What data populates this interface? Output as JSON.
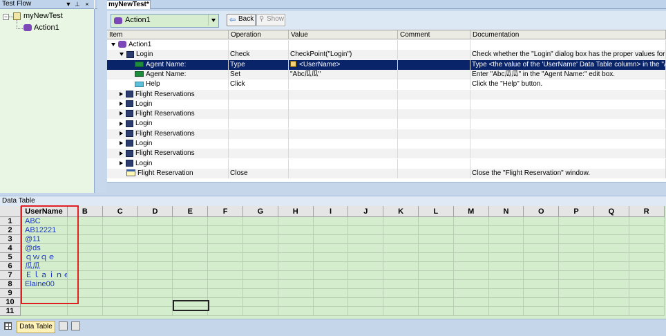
{
  "test_flow": {
    "title": "Test Flow",
    "header_buttons": [
      "▼",
      "⊥",
      "×"
    ],
    "root": "myNewTest",
    "child": "Action1"
  },
  "document": {
    "tab_label": "myNewTest*",
    "action_selected": "Action1",
    "back_label": "Back",
    "show_label": "Show",
    "columns": [
      "Item",
      "Operation",
      "Value",
      "Comment",
      "Documentation"
    ],
    "rows": [
      {
        "expander": "down",
        "icon": "action",
        "item": "Action1",
        "operation": "",
        "value": "",
        "comment": "",
        "documentation": "",
        "indent": 0
      },
      {
        "expander": "down",
        "icon": "obj",
        "item": "Login",
        "operation": "Check",
        "value": "CheckPoint(\"Login\")",
        "comment": "",
        "documentation": "Check whether the \"Login\" dialog box has the proper values for the selecte",
        "indent": 1
      },
      {
        "expander": "",
        "icon": "edit",
        "item": "Agent Name:",
        "operation": "Type",
        "value": "<UserName>",
        "comment": "",
        "documentation": "Type <the value of the 'UserName' Data Table column> in the \"Agent Nam",
        "indent": 2,
        "selected": true
      },
      {
        "expander": "",
        "icon": "edit",
        "item": "Agent Name:",
        "operation": "Set",
        "value": "\"Abc瓜瓜\"",
        "comment": "",
        "documentation": "Enter \"Abc瓜瓜\" in the \"Agent Name:\" edit box.",
        "indent": 2
      },
      {
        "expander": "",
        "icon": "btn",
        "item": "Help",
        "operation": "Click",
        "value": "",
        "comment": "",
        "documentation": "Click the \"Help\" button.",
        "indent": 2
      },
      {
        "expander": "right",
        "icon": "obj",
        "item": "Flight Reservations",
        "operation": "",
        "value": "",
        "comment": "",
        "documentation": "",
        "indent": 1
      },
      {
        "expander": "right",
        "icon": "obj",
        "item": "Login",
        "operation": "",
        "value": "",
        "comment": "",
        "documentation": "",
        "indent": 1
      },
      {
        "expander": "right",
        "icon": "obj",
        "item": "Flight Reservations",
        "operation": "",
        "value": "",
        "comment": "",
        "documentation": "",
        "indent": 1
      },
      {
        "expander": "right",
        "icon": "obj",
        "item": "Login",
        "operation": "",
        "value": "",
        "comment": "",
        "documentation": "",
        "indent": 1
      },
      {
        "expander": "right",
        "icon": "obj",
        "item": "Flight Reservations",
        "operation": "",
        "value": "",
        "comment": "",
        "documentation": "",
        "indent": 1
      },
      {
        "expander": "right",
        "icon": "obj",
        "item": "Login",
        "operation": "",
        "value": "",
        "comment": "",
        "documentation": "",
        "indent": 1
      },
      {
        "expander": "right",
        "icon": "obj",
        "item": "Flight Reservations",
        "operation": "",
        "value": "",
        "comment": "",
        "documentation": "",
        "indent": 1
      },
      {
        "expander": "right",
        "icon": "obj",
        "item": "Login",
        "operation": "",
        "value": "",
        "comment": "",
        "documentation": "",
        "indent": 1
      },
      {
        "expander": "",
        "icon": "win",
        "item": "Flight Reservation",
        "operation": "Close",
        "value": "",
        "comment": "",
        "documentation": "Close the \"Flight Reservation\" window.",
        "indent": 1
      }
    ]
  },
  "data_table": {
    "title": "Data Table",
    "columns": [
      "UserName",
      "B",
      "C",
      "D",
      "E",
      "F",
      "G",
      "H",
      "I",
      "J",
      "K",
      "L",
      "M",
      "N",
      "O",
      "P",
      "Q",
      "R"
    ],
    "row_numbers": [
      "1",
      "2",
      "3",
      "4",
      "5",
      "6",
      "7",
      "8",
      "9",
      "10",
      "11"
    ],
    "username_values": [
      "ABC",
      "AB12221",
      "@11",
      "@ds",
      "ｑｗｑｅ",
      "瓜瓜",
      "Ｅｌａｉｎｅ",
      "Elaine00",
      "",
      "",
      ""
    ],
    "sheet_tab": "Data Table"
  },
  "colors": {
    "selection": "#0a246a",
    "highlight_border": "#e02020",
    "grid_green": "#d4edcc",
    "cell_text": "#1a35c9"
  }
}
